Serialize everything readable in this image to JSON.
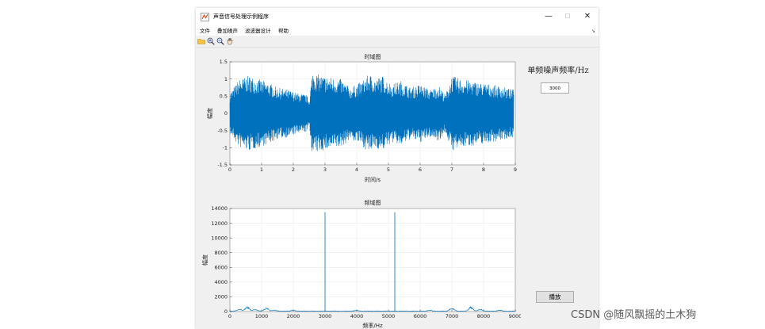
{
  "window": {
    "title": "声音信号处理示例程序",
    "minimize": "—",
    "maximize": "☐",
    "close": "✕"
  },
  "menubar": {
    "items": [
      "文件",
      "叠加噪声",
      "滤波器设计",
      "帮助"
    ],
    "overflow_arrow": "➘"
  },
  "toolbar": {
    "icons": [
      "open-folder-icon",
      "zoom-in-icon",
      "zoom-out-icon",
      "pan-hand-icon"
    ]
  },
  "controls": {
    "noise_freq_label": "单频噪声频率/Hz",
    "noise_freq_value": "3000",
    "play_label": "播放"
  },
  "watermark": "CSDN @随风飘摇的土木狗",
  "colors": {
    "plot_line": "#0072bd",
    "axes_bg": "#ffffff",
    "figure_bg": "#f0f0f0",
    "grid": "#e6e6e6"
  },
  "chart_data": [
    {
      "type": "line",
      "title": "时域图",
      "xlabel": "时间/s",
      "ylabel": "幅度",
      "xlim": [
        0,
        9
      ],
      "ylim": [
        -1.5,
        1.5
      ],
      "xticks": [
        "0",
        "1",
        "2",
        "3",
        "4",
        "5",
        "6",
        "7",
        "8",
        "9"
      ],
      "yticks": [
        "-1.5",
        "-1",
        "-0.5",
        "0",
        "0.5",
        "1",
        "1.5"
      ],
      "grid": true,
      "envelope": {
        "t": [
          0,
          0.3,
          0.6,
          0.9,
          1.2,
          1.5,
          1.8,
          2.1,
          2.4,
          2.5,
          2.6,
          2.9,
          3.2,
          3.5,
          3.8,
          4.1,
          4.4,
          4.6,
          4.8,
          5.1,
          5.4,
          5.7,
          6.0,
          6.3,
          6.6,
          6.8,
          7.0,
          7.3,
          7.6,
          7.9,
          8.2,
          8.5,
          8.9
        ],
        "amp": [
          0.6,
          1.0,
          1.1,
          1.0,
          0.9,
          0.75,
          0.7,
          0.6,
          0.55,
          0.4,
          1.2,
          1.1,
          1.05,
          1.0,
          0.75,
          0.9,
          1.15,
          1.0,
          1.1,
          0.85,
          0.95,
          0.75,
          0.85,
          0.7,
          0.8,
          0.55,
          1.1,
          1.0,
          0.95,
          0.9,
          0.85,
          0.8,
          0.7
        ]
      }
    },
    {
      "type": "line",
      "title": "频域图",
      "xlabel": "频率/Hz",
      "ylabel": "幅度",
      "xlim": [
        0,
        9000
      ],
      "ylim": [
        0,
        14000
      ],
      "xticks": [
        "0",
        "1000",
        "2000",
        "3000",
        "4000",
        "5000",
        "6000",
        "7000",
        "8000",
        "9000"
      ],
      "yticks": [
        "0",
        "2000",
        "4000",
        "6000",
        "8000",
        "10000",
        "12000",
        "14000"
      ],
      "grid": true,
      "peaks": [
        {
          "x": 3000,
          "y": 13500
        },
        {
          "x": 5200,
          "y": 13500
        }
      ],
      "baseline_bumps": [
        {
          "x": 300,
          "y": 300
        },
        {
          "x": 550,
          "y": 700
        },
        {
          "x": 800,
          "y": 250
        },
        {
          "x": 1150,
          "y": 500
        },
        {
          "x": 1400,
          "y": 150
        },
        {
          "x": 2000,
          "y": 100
        },
        {
          "x": 4000,
          "y": 120
        },
        {
          "x": 6300,
          "y": 100
        },
        {
          "x": 7000,
          "y": 500
        },
        {
          "x": 7600,
          "y": 650
        },
        {
          "x": 7900,
          "y": 300
        },
        {
          "x": 8500,
          "y": 150
        }
      ]
    }
  ]
}
